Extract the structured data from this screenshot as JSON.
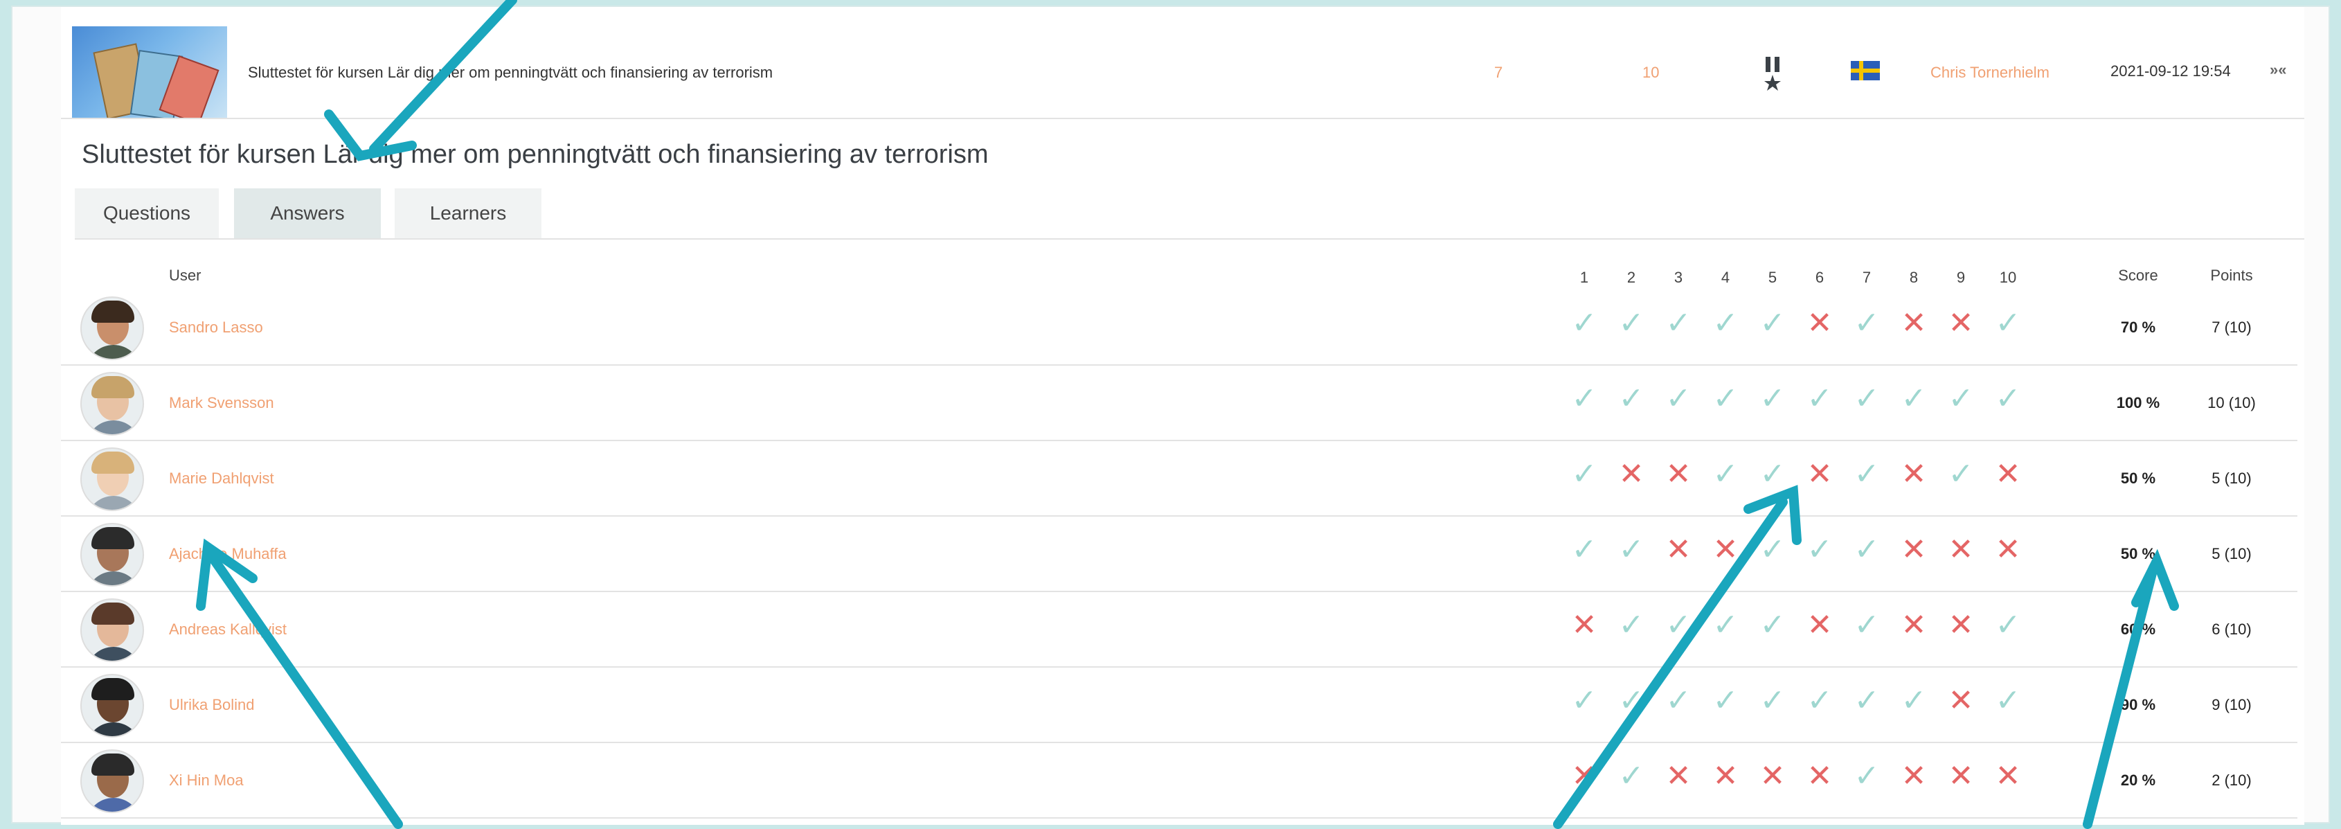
{
  "summary": {
    "title": "Sluttestet för kursen Lär dig mer om penningtvätt och finansiering av terrorism",
    "num_questions": "7",
    "max_points": "10",
    "author": "Chris Tornerhielm",
    "date": "2021-09-12 19:54",
    "collapse_glyph": "»«"
  },
  "quiz_title": "Sluttestet för kursen Lär dig mer om penningtvätt och finansiering av terrorism",
  "tabs": [
    {
      "label": "Questions",
      "active": false
    },
    {
      "label": "Answers",
      "active": true
    },
    {
      "label": "Learners",
      "active": false
    }
  ],
  "table": {
    "header_user": "User",
    "question_numbers": [
      "1",
      "2",
      "3",
      "4",
      "5",
      "6",
      "7",
      "8",
      "9",
      "10"
    ],
    "header_score": "Score",
    "header_points": "Points",
    "rows": [
      {
        "name": "Sandro Lasso",
        "answers": [
          1,
          1,
          1,
          1,
          1,
          0,
          1,
          0,
          0,
          1
        ],
        "score": "70 %",
        "points": "7 (10)"
      },
      {
        "name": "Mark Svensson",
        "answers": [
          1,
          1,
          1,
          1,
          1,
          1,
          1,
          1,
          1,
          1
        ],
        "score": "100 %",
        "points": "10 (10)"
      },
      {
        "name": "Marie Dahlqvist",
        "answers": [
          1,
          0,
          0,
          1,
          1,
          0,
          1,
          0,
          1,
          0
        ],
        "score": "50 %",
        "points": "5 (10)"
      },
      {
        "name": "Ajachine Muhaffa",
        "answers": [
          1,
          1,
          0,
          0,
          1,
          1,
          1,
          0,
          0,
          0
        ],
        "score": "50 %",
        "points": "5 (10)"
      },
      {
        "name": "Andreas Kallqvist",
        "answers": [
          0,
          1,
          1,
          1,
          1,
          0,
          1,
          0,
          0,
          1
        ],
        "score": "60 %",
        "points": "6 (10)"
      },
      {
        "name": "Ulrika Bolind",
        "answers": [
          1,
          1,
          1,
          1,
          1,
          1,
          1,
          1,
          0,
          1
        ],
        "score": "90 %",
        "points": "9 (10)"
      },
      {
        "name": "Xi Hin Moa",
        "answers": [
          0,
          1,
          0,
          0,
          0,
          0,
          1,
          0,
          0,
          0
        ],
        "score": "20 %",
        "points": "2 (10)"
      }
    ]
  },
  "colors": {
    "accent_orange": "#f0a072",
    "correct": "#9fd7d0",
    "wrong": "#e46565",
    "arrow": "#1aa6bd"
  },
  "icons": {
    "correct": "check-icon",
    "wrong": "cross-icon",
    "medal": "medal-icon",
    "flag": "swedish-flag-icon"
  }
}
